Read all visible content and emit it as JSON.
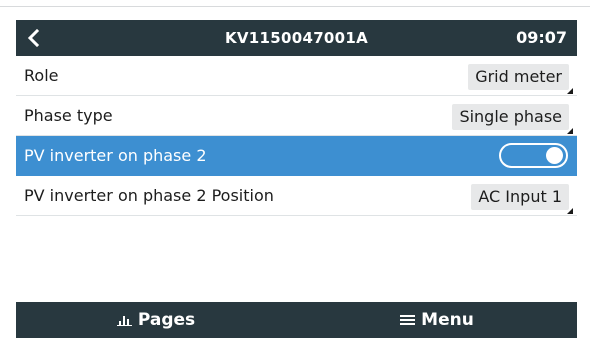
{
  "header": {
    "title": "KV1150047001A",
    "time": "09:07"
  },
  "rows": [
    {
      "label": "Role",
      "value": "Grid meter"
    },
    {
      "label": "Phase type",
      "value": "Single phase"
    },
    {
      "label": "PV inverter on phase 2",
      "toggle_on": true
    },
    {
      "label": "PV inverter on phase 2 Position",
      "value": "AC Input 1"
    }
  ],
  "footer": {
    "pages_label": "Pages",
    "menu_label": "Menu"
  },
  "icons": {
    "back": "chevron-left-icon",
    "pages": "bar-chart-icon",
    "menu": "hamburger-menu-icon"
  },
  "colors": {
    "bar": "#28383f",
    "selection": "#3d8fd1",
    "value_box": "#e7e8e9"
  }
}
